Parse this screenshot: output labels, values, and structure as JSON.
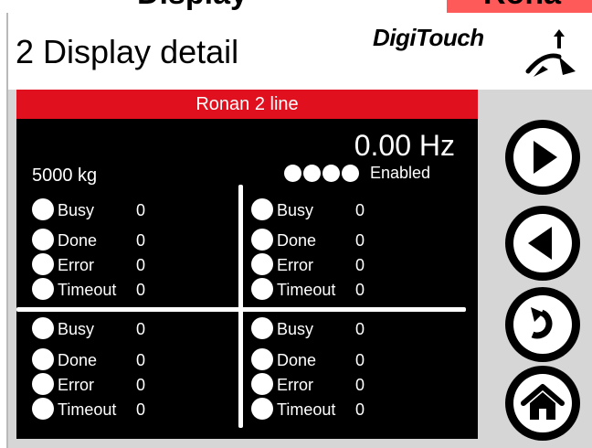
{
  "top": {
    "cut_title": "Display",
    "cut_right": "Rona"
  },
  "header": {
    "title": "2 Display detail",
    "logo_text": "DigiTouch"
  },
  "banner": "Ronan 2 line",
  "frequency": "0.00 Hz",
  "weight": "5000 kg",
  "status": {
    "label": "Enabled",
    "led_count": 4
  },
  "quadrants": [
    {
      "rows": [
        {
          "label": "Busy",
          "value": "0"
        },
        {
          "label": "Done",
          "value": "0"
        },
        {
          "label": "Error",
          "value": "0"
        },
        {
          "label": "Timeout",
          "value": "0"
        }
      ]
    },
    {
      "rows": [
        {
          "label": "Busy",
          "value": "0"
        },
        {
          "label": "Done",
          "value": "0"
        },
        {
          "label": "Error",
          "value": "0"
        },
        {
          "label": "Timeout",
          "value": "0"
        }
      ]
    },
    {
      "rows": [
        {
          "label": "Busy",
          "value": "0"
        },
        {
          "label": "Done",
          "value": "0"
        },
        {
          "label": "Error",
          "value": "0"
        },
        {
          "label": "Timeout",
          "value": "0"
        }
      ]
    },
    {
      "rows": [
        {
          "label": "Busy",
          "value": "0"
        },
        {
          "label": "Done",
          "value": "0"
        },
        {
          "label": "Error",
          "value": "0"
        },
        {
          "label": "Timeout",
          "value": "0"
        }
      ]
    }
  ],
  "nav_buttons": [
    "play-forward-icon",
    "play-back-icon",
    "return-icon",
    "home-icon"
  ]
}
